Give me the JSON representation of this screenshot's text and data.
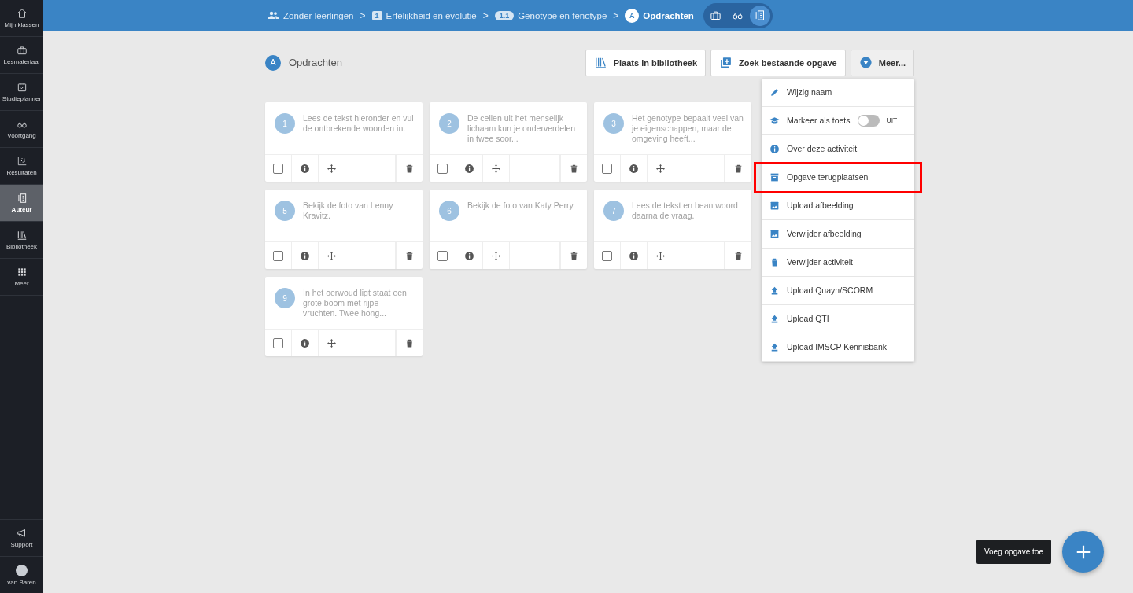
{
  "sidebar": {
    "items": [
      {
        "label": "Mijn klassen",
        "selected": false
      },
      {
        "label": "Lesmateriaal",
        "selected": false
      },
      {
        "label": "Studieplanner",
        "selected": false
      },
      {
        "label": "Voortgang",
        "selected": false
      },
      {
        "label": "Resultaten",
        "selected": false
      },
      {
        "label": "Auteur",
        "selected": true
      },
      {
        "label": "Bibliotheek",
        "selected": false
      },
      {
        "label": "Meer",
        "selected": false
      }
    ],
    "footer": [
      {
        "label": "Support"
      },
      {
        "label": "van Baren"
      }
    ]
  },
  "breadcrumbs": [
    {
      "kind": "group",
      "label": "Zonder leerlingen"
    },
    {
      "kind": "badge",
      "separator": ">",
      "badge": "1",
      "label": "Erfelijkheid en evolutie"
    },
    {
      "kind": "pill",
      "separator": ">",
      "badge": "1.1",
      "label": "Genotype en fenotype"
    },
    {
      "kind": "circle",
      "separator": ">",
      "badge": "A",
      "label": "Opdrachten"
    }
  ],
  "view_switch": [
    {
      "selected": false
    },
    {
      "selected": false
    },
    {
      "selected": true
    }
  ],
  "header": {
    "badge": "A",
    "title": "Opdrachten"
  },
  "actions": [
    {
      "label": "Plaats in bibliotheek"
    },
    {
      "label": "Zoek bestaande opgave"
    },
    {
      "label": "Meer..."
    }
  ],
  "menu": [
    {
      "kind": "action",
      "label": "Wijzig naam",
      "highlighted": false
    },
    {
      "kind": "toggle",
      "label": "Markeer als toets",
      "on": false,
      "state_label": "UIT",
      "highlighted": false
    },
    {
      "kind": "action",
      "label": "Over deze activiteit",
      "highlighted": false
    },
    {
      "kind": "action",
      "label": "Opgave terugplaatsen",
      "highlighted": true
    },
    {
      "kind": "action",
      "label": "Upload afbeelding",
      "highlighted": false
    },
    {
      "kind": "action",
      "label": "Verwijder afbeelding",
      "highlighted": false
    },
    {
      "kind": "action",
      "label": "Verwijder activiteit",
      "highlighted": false
    },
    {
      "kind": "action",
      "label": "Upload Quayn/SCORM",
      "highlighted": false
    },
    {
      "kind": "action",
      "label": "Upload QTI",
      "highlighted": false
    },
    {
      "kind": "action",
      "label": "Upload IMSCP Kennisbank",
      "highlighted": false
    }
  ],
  "cards": [
    {
      "number": "1",
      "text": "Lees de tekst hieronder en vul de ontbrekende woorden in.",
      "checked": false
    },
    {
      "number": "2",
      "text": "De cellen uit het menselijk lichaam kun je onderverdelen in twee soor...",
      "checked": false
    },
    {
      "number": "3",
      "text": "Het genotype bepaalt veel van je eigenschappen, maar de omgeving heeft...",
      "checked": false
    },
    {
      "number": "5",
      "text": "Bekijk de foto van Lenny Kravitz.",
      "checked": false
    },
    {
      "number": "6",
      "text": "Bekijk de foto van Katy Perry.",
      "checked": false
    },
    {
      "number": "7",
      "text": "Lees de tekst en beantwoord daarna de vraag.",
      "checked": false
    },
    {
      "number": "9",
      "text": "In het oerwoud ligt staat een grote boom met rijpe vruchten. Twee hong...",
      "checked": false
    }
  ],
  "fab": {
    "tooltip": "Voeg opgave toe"
  }
}
